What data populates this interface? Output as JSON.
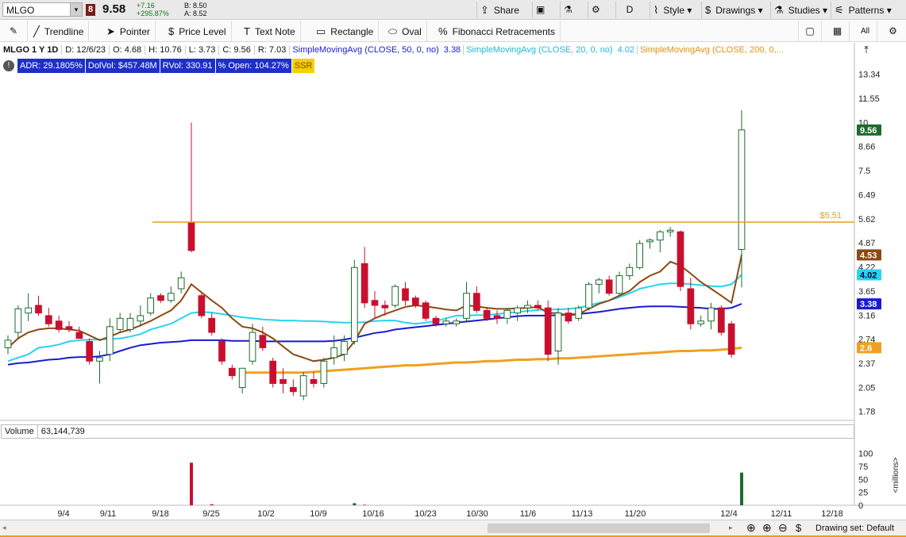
{
  "topbar": {
    "symbol": "MLGO",
    "flag": "8",
    "last_price": "9.58",
    "change": "+7.16",
    "change_pct": "+295.87%",
    "bid": "B: 8.50",
    "ask": "A: 8.52",
    "share_label": "Share",
    "timeframe": "D",
    "style_label": "Style",
    "drawings_label": "Drawings",
    "studies_label": "Studies",
    "patterns_label": "Patterns"
  },
  "toolbar": {
    "trendline": "Trendline",
    "pointer": "Pointer",
    "price_level": "Price Level",
    "text_note": "Text Note",
    "rectangle": "Rectangle",
    "oval": "Oval",
    "fibonacci": "Fibonacci Retracements",
    "all_label": "All"
  },
  "infobar": {
    "title": "MLGO 1 Y 1D",
    "date": "D: 12/6/23",
    "open": "O: 4.68",
    "high": "H: 10.76",
    "low": "L: 3.73",
    "close": "C: 9.56",
    "range": "R: 7.03",
    "sma50_label": "SimpleMovingAvg (CLOSE, 50, 0, no)",
    "sma50_value": "3.38",
    "sma20_label": "SimpleMovingAvg (CLOSE, 20, 0, no)",
    "sma20_value": "4.02",
    "sma200_label": "SimpleMovingAvg (CLOSE, 200, 0,..."
  },
  "stats": {
    "adr": "ADR: 29.1805%",
    "dolvol": "DolVol: $457.48M",
    "rvol": "RVol: 330.91",
    "open_pct": "% Open: 104.27%",
    "ssr": "SSR"
  },
  "price_level": {
    "label": "$5.51",
    "value": 5.51
  },
  "right_axis_ticks": [
    "13.34",
    "11.55",
    "10",
    "8.66",
    "7.5",
    "6.49",
    "5.62",
    "4.87",
    "4.22",
    "3.65",
    "3.16",
    "2.74",
    "2.37",
    "2.05",
    "1.78"
  ],
  "badges": [
    {
      "label": "9.56",
      "color": "#1e6b2e"
    },
    {
      "label": "4.53",
      "color": "#8b4a12"
    },
    {
      "label": "4.02",
      "color": "#27d4f0"
    },
    {
      "label": "3.38",
      "color": "#1a1ad0"
    },
    {
      "label": "2.6",
      "color": "#f0a020"
    }
  ],
  "x_axis": [
    "9/4",
    "9/11",
    "9/18",
    "9/25",
    "10/2",
    "10/9",
    "10/16",
    "10/23",
    "10/30",
    "11/6",
    "11/13",
    "11/20",
    "12/4",
    "12/11",
    "12/18"
  ],
  "volume": {
    "label": "Volume",
    "value": "63,144,739",
    "axis": [
      "100",
      "75",
      "50",
      "25",
      "0"
    ],
    "unit": "<millions>"
  },
  "bottombar": {
    "drawing_set": "Drawing set: Default"
  },
  "colors": {
    "up": "#1e6b2e",
    "down": "#c8102e",
    "sma200": "#f0a020",
    "sma50": "#1a1ad0",
    "sma20": "#27d4f0",
    "ema": "#8b4a12",
    "price_level": "#e0a020"
  },
  "chart_data": {
    "type": "candlestick",
    "title": "MLGO 1 Y 1D",
    "candles": [
      {
        "date": "8/29",
        "o": 2.6,
        "h": 2.8,
        "l": 2.5,
        "c": 2.72
      },
      {
        "date": "8/30",
        "o": 2.85,
        "h": 3.35,
        "l": 2.75,
        "c": 3.28
      },
      {
        "date": "8/31",
        "o": 3.2,
        "h": 3.6,
        "l": 3.05,
        "c": 3.3
      },
      {
        "date": "9/1",
        "o": 3.35,
        "h": 3.55,
        "l": 3.15,
        "c": 3.2
      },
      {
        "date": "9/5",
        "o": 3.15,
        "h": 3.3,
        "l": 2.95,
        "c": 3.0
      },
      {
        "date": "9/6",
        "o": 3.05,
        "h": 3.15,
        "l": 2.85,
        "c": 2.9
      },
      {
        "date": "9/7",
        "o": 2.95,
        "h": 3.05,
        "l": 2.85,
        "c": 2.9
      },
      {
        "date": "9/8",
        "o": 2.85,
        "h": 2.95,
        "l": 2.75,
        "c": 2.75
      },
      {
        "date": "9/11",
        "o": 2.7,
        "h": 2.75,
        "l": 2.35,
        "c": 2.4
      },
      {
        "date": "9/12",
        "o": 2.4,
        "h": 2.55,
        "l": 2.1,
        "c": 2.45
      },
      {
        "date": "9/13",
        "o": 2.5,
        "h": 3.1,
        "l": 2.4,
        "c": 2.95
      },
      {
        "date": "9/14",
        "o": 2.9,
        "h": 3.2,
        "l": 2.85,
        "c": 3.1
      },
      {
        "date": "9/15",
        "o": 2.9,
        "h": 3.2,
        "l": 2.85,
        "c": 3.1
      },
      {
        "date": "9/18",
        "o": 3.05,
        "h": 3.35,
        "l": 2.95,
        "c": 3.15
      },
      {
        "date": "9/19",
        "o": 3.2,
        "h": 3.6,
        "l": 3.15,
        "c": 3.5
      },
      {
        "date": "9/20",
        "o": 3.55,
        "h": 3.6,
        "l": 3.4,
        "c": 3.45
      },
      {
        "date": "9/21",
        "o": 3.45,
        "h": 3.75,
        "l": 3.4,
        "c": 3.6
      },
      {
        "date": "9/22",
        "o": 3.7,
        "h": 4.1,
        "l": 3.6,
        "c": 3.95
      },
      {
        "date": "9/25",
        "o": 5.5,
        "h": 10.0,
        "l": 4.6,
        "c": 4.65
      },
      {
        "date": "9/26",
        "o": 3.55,
        "h": 3.6,
        "l": 3.1,
        "c": 3.15
      },
      {
        "date": "9/27",
        "o": 3.1,
        "h": 3.2,
        "l": 2.8,
        "c": 2.85
      },
      {
        "date": "9/28",
        "o": 2.7,
        "h": 2.75,
        "l": 2.35,
        "c": 2.4
      },
      {
        "date": "9/29",
        "o": 2.3,
        "h": 2.35,
        "l": 2.15,
        "c": 2.2
      },
      {
        "date": "10/2",
        "o": 2.05,
        "h": 2.3,
        "l": 1.98,
        "c": 2.3
      },
      {
        "date": "10/3",
        "o": 2.4,
        "h": 3.0,
        "l": 2.35,
        "c": 2.85
      },
      {
        "date": "10/4",
        "o": 2.8,
        "h": 2.95,
        "l": 2.55,
        "c": 2.6
      },
      {
        "date": "10/5",
        "o": 2.4,
        "h": 2.45,
        "l": 2.05,
        "c": 2.1
      },
      {
        "date": "10/6",
        "o": 2.15,
        "h": 2.3,
        "l": 1.98,
        "c": 2.1
      },
      {
        "date": "10/9",
        "o": 2.05,
        "h": 2.15,
        "l": 1.95,
        "c": 2.0
      },
      {
        "date": "10/10",
        "o": 1.95,
        "h": 2.25,
        "l": 1.9,
        "c": 2.2
      },
      {
        "date": "10/11",
        "o": 2.15,
        "h": 2.25,
        "l": 2.05,
        "c": 2.1
      },
      {
        "date": "10/12",
        "o": 2.1,
        "h": 2.45,
        "l": 2.05,
        "c": 2.4
      },
      {
        "date": "10/13",
        "o": 2.45,
        "h": 2.8,
        "l": 2.35,
        "c": 2.6
      },
      {
        "date": "10/16",
        "o": 2.5,
        "h": 2.8,
        "l": 2.4,
        "c": 2.7
      },
      {
        "date": "10/17",
        "o": 2.7,
        "h": 4.4,
        "l": 2.65,
        "c": 4.2
      },
      {
        "date": "10/18",
        "o": 4.3,
        "h": 4.75,
        "l": 3.3,
        "c": 3.4
      },
      {
        "date": "10/19",
        "o": 3.45,
        "h": 3.65,
        "l": 3.1,
        "c": 3.35
      },
      {
        "date": "10/20",
        "o": 3.35,
        "h": 3.45,
        "l": 3.15,
        "c": 3.3
      },
      {
        "date": "10/23",
        "o": 3.35,
        "h": 3.8,
        "l": 3.3,
        "c": 3.75
      },
      {
        "date": "10/24",
        "o": 3.7,
        "h": 3.85,
        "l": 3.35,
        "c": 3.45
      },
      {
        "date": "10/25",
        "o": 3.5,
        "h": 3.55,
        "l": 3.3,
        "c": 3.35
      },
      {
        "date": "10/26",
        "o": 3.4,
        "h": 3.45,
        "l": 3.05,
        "c": 3.1
      },
      {
        "date": "10/27",
        "o": 3.1,
        "h": 3.15,
        "l": 2.95,
        "c": 3.0
      },
      {
        "date": "10/30",
        "o": 3.0,
        "h": 3.1,
        "l": 2.95,
        "c": 3.05
      },
      {
        "date": "10/31",
        "o": 3.0,
        "h": 3.1,
        "l": 2.95,
        "c": 3.05
      },
      {
        "date": "11/1",
        "o": 3.1,
        "h": 3.85,
        "l": 3.05,
        "c": 3.6
      },
      {
        "date": "11/2",
        "o": 3.6,
        "h": 3.75,
        "l": 3.2,
        "c": 3.25
      },
      {
        "date": "11/3",
        "o": 3.25,
        "h": 3.3,
        "l": 3.05,
        "c": 3.1
      },
      {
        "date": "11/6",
        "o": 3.15,
        "h": 3.25,
        "l": 3.0,
        "c": 3.1
      },
      {
        "date": "11/7",
        "o": 3.1,
        "h": 3.3,
        "l": 3.0,
        "c": 3.25
      },
      {
        "date": "11/8",
        "o": 3.2,
        "h": 3.35,
        "l": 3.05,
        "c": 3.3
      },
      {
        "date": "11/9",
        "o": 3.3,
        "h": 3.45,
        "l": 3.2,
        "c": 3.35
      },
      {
        "date": "11/10",
        "o": 3.35,
        "h": 3.45,
        "l": 3.25,
        "c": 3.3
      },
      {
        "date": "11/13",
        "o": 3.3,
        "h": 3.45,
        "l": 2.4,
        "c": 2.5
      },
      {
        "date": "11/14",
        "o": 2.55,
        "h": 3.3,
        "l": 2.35,
        "c": 3.2
      },
      {
        "date": "11/15",
        "o": 3.2,
        "h": 3.3,
        "l": 3.0,
        "c": 3.05
      },
      {
        "date": "11/16",
        "o": 3.1,
        "h": 3.35,
        "l": 3.05,
        "c": 3.3
      },
      {
        "date": "11/17",
        "o": 3.3,
        "h": 3.85,
        "l": 3.25,
        "c": 3.8
      },
      {
        "date": "11/20",
        "o": 3.8,
        "h": 3.95,
        "l": 3.6,
        "c": 3.9
      },
      {
        "date": "11/21",
        "o": 3.9,
        "h": 4.0,
        "l": 3.55,
        "c": 3.6
      },
      {
        "date": "11/22",
        "o": 3.6,
        "h": 4.1,
        "l": 3.55,
        "c": 4.0
      },
      {
        "date": "11/24",
        "o": 4.0,
        "h": 4.3,
        "l": 3.9,
        "c": 4.2
      },
      {
        "date": "11/27",
        "o": 4.2,
        "h": 4.95,
        "l": 4.15,
        "c": 4.85
      },
      {
        "date": "11/28",
        "o": 4.9,
        "h": 5.0,
        "l": 4.7,
        "c": 4.95
      },
      {
        "date": "11/29",
        "o": 4.95,
        "h": 5.25,
        "l": 4.6,
        "c": 5.2
      },
      {
        "date": "11/30",
        "o": 5.2,
        "h": 5.35,
        "l": 5.05,
        "c": 5.25
      },
      {
        "date": "12/1",
        "o": 5.2,
        "h": 5.25,
        "l": 3.65,
        "c": 3.75
      },
      {
        "date": "12/4",
        "o": 3.7,
        "h": 3.95,
        "l": 2.9,
        "c": 3.0
      },
      {
        "date": "12/5",
        "o": 3.0,
        "h": 3.15,
        "l": 2.95,
        "c": 3.05
      },
      {
        "date": "12/6a",
        "o": 3.05,
        "h": 3.4,
        "l": 2.9,
        "c": 3.3
      },
      {
        "date": "12/6b",
        "o": 3.3,
        "h": 3.35,
        "l": 2.8,
        "c": 2.85
      },
      {
        "date": "12/6c",
        "o": 3.0,
        "h": 3.05,
        "l": 2.45,
        "c": 2.5
      },
      {
        "date": "12/6",
        "o": 4.68,
        "h": 10.76,
        "l": 3.73,
        "c": 9.56
      }
    ],
    "sma20": [
      2.4,
      2.45,
      2.5,
      2.6,
      2.62,
      2.65,
      2.7,
      2.72,
      2.73,
      2.73,
      2.74,
      2.75,
      2.78,
      2.82,
      2.9,
      2.95,
      3.0,
      3.1,
      3.2,
      3.22,
      3.21,
      3.18,
      3.15,
      3.12,
      3.1,
      3.08,
      3.07,
      3.06,
      3.06,
      3.05,
      3.05,
      3.04,
      3.03,
      3.02,
      3.02,
      3.03,
      3.05,
      3.06,
      3.06,
      3.02,
      3.0,
      3.02,
      3.05,
      3.1,
      3.15,
      3.15,
      3.16,
      3.16,
      3.18,
      3.2,
      3.22,
      3.24,
      3.26,
      3.27,
      3.27,
      3.28,
      3.3,
      3.35,
      3.4,
      3.45,
      3.52,
      3.6,
      3.7,
      3.75,
      3.8,
      3.82,
      3.82,
      3.8,
      3.78,
      3.76,
      3.75,
      3.8,
      4.02
    ],
    "sma50": [
      2.35,
      2.37,
      2.38,
      2.4,
      2.42,
      2.43,
      2.45,
      2.46,
      2.46,
      2.47,
      2.5,
      2.55,
      2.6,
      2.64,
      2.66,
      2.68,
      2.69,
      2.7,
      2.72,
      2.72,
      2.72,
      2.72,
      2.71,
      2.71,
      2.71,
      2.7,
      2.7,
      2.7,
      2.7,
      2.7,
      2.7,
      2.7,
      2.71,
      2.73,
      2.76,
      2.8,
      2.84,
      2.86,
      2.9,
      2.92,
      2.94,
      2.96,
      2.98,
      3.0,
      3.02,
      3.04,
      3.06,
      3.08,
      3.1,
      3.12,
      3.14,
      3.15,
      3.15,
      3.15,
      3.16,
      3.17,
      3.18,
      3.2,
      3.22,
      3.25,
      3.28,
      3.3,
      3.32,
      3.33,
      3.33,
      3.33,
      3.32,
      3.31,
      3.3,
      3.28,
      3.28,
      3.3,
      3.38
    ],
    "sma200": [
      null,
      null,
      null,
      null,
      null,
      null,
      null,
      null,
      null,
      null,
      null,
      null,
      null,
      null,
      null,
      null,
      null,
      null,
      null,
      null,
      null,
      null,
      null,
      2.24,
      2.24,
      2.24,
      2.24,
      2.24,
      2.24,
      2.24,
      2.25,
      2.26,
      2.27,
      2.28,
      2.29,
      2.3,
      2.31,
      2.32,
      2.33,
      2.34,
      2.34,
      2.35,
      2.36,
      2.37,
      2.38,
      2.38,
      2.39,
      2.4,
      2.4,
      2.41,
      2.42,
      2.42,
      2.43,
      2.43,
      2.44,
      2.44,
      2.45,
      2.46,
      2.47,
      2.48,
      2.49,
      2.5,
      2.51,
      2.52,
      2.53,
      2.54,
      2.55,
      2.55,
      2.56,
      2.56,
      2.57,
      2.58,
      2.6
    ],
    "ema": [
      2.6,
      2.75,
      2.85,
      2.9,
      2.92,
      2.92,
      2.9,
      2.88,
      2.8,
      2.72,
      2.78,
      2.85,
      2.9,
      2.97,
      3.05,
      3.15,
      3.25,
      3.45,
      3.8,
      3.62,
      3.45,
      3.3,
      3.1,
      2.95,
      2.92,
      2.85,
      2.75,
      2.62,
      2.5,
      2.45,
      2.4,
      2.42,
      2.45,
      2.5,
      2.7,
      3.0,
      3.1,
      3.18,
      3.25,
      3.32,
      3.35,
      3.33,
      3.3,
      3.27,
      3.25,
      3.35,
      3.33,
      3.3,
      3.28,
      3.28,
      3.29,
      3.3,
      3.32,
      3.2,
      3.2,
      3.15,
      3.18,
      3.28,
      3.38,
      3.45,
      3.55,
      3.65,
      3.85,
      4.0,
      4.1,
      4.35,
      4.25,
      4.05,
      3.85,
      3.7,
      3.55,
      3.4,
      4.53
    ],
    "volume": [
      0,
      0,
      0,
      0,
      0,
      0,
      0,
      0,
      0,
      0,
      0,
      0,
      0,
      0,
      0,
      0,
      0,
      0,
      82,
      0,
      2,
      0,
      0,
      0,
      0,
      0,
      0,
      0,
      0,
      0,
      0,
      0,
      0,
      0,
      4,
      1,
      0,
      0,
      0,
      0,
      0,
      0,
      0,
      0,
      0,
      0,
      0,
      0,
      0,
      0,
      0,
      0,
      0,
      0,
      0,
      0,
      0,
      0,
      0,
      0,
      0,
      0,
      0,
      0,
      0,
      0,
      0,
      0,
      0,
      0,
      0,
      0,
      63
    ],
    "ylim": [
      1.7,
      14.5
    ],
    "log_scale": true,
    "grid": false
  }
}
